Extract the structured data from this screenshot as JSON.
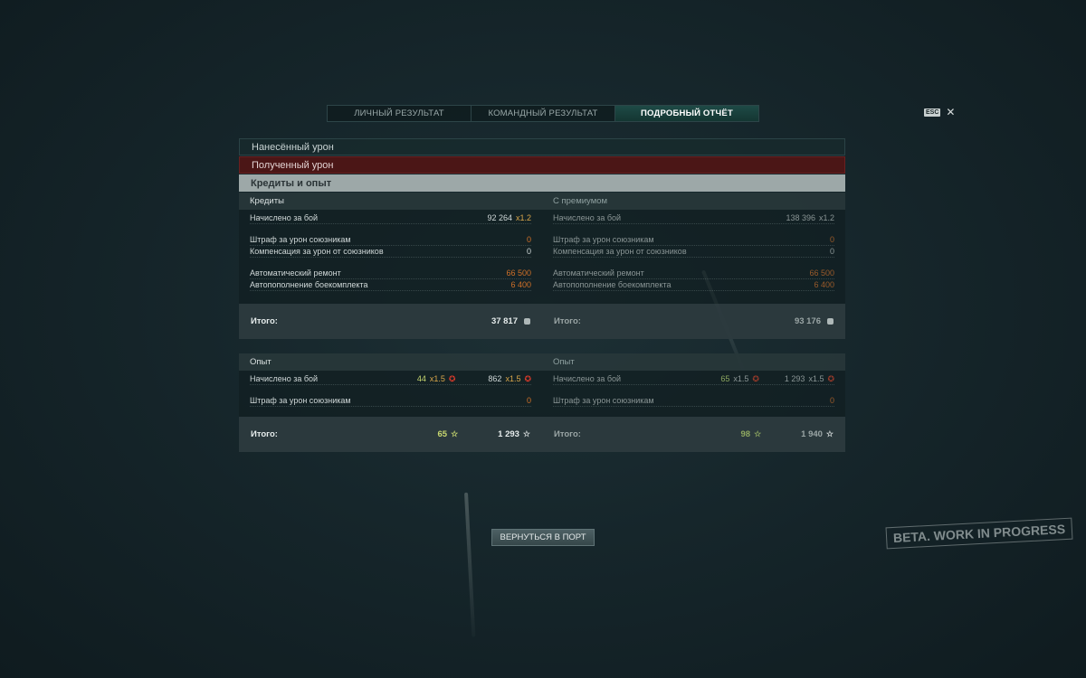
{
  "tabs": [
    {
      "label": "ЛИЧНЫЙ РЕЗУЛЬТАТ",
      "active": false
    },
    {
      "label": "КОМАНДНЫЙ РЕЗУЛЬТАТ",
      "active": false
    },
    {
      "label": "ПОДРОБНЫЙ ОТЧЁТ",
      "active": true
    }
  ],
  "esc": {
    "key": "ESC",
    "close": "✕"
  },
  "sections": {
    "damage_dealt": "Нанесённый урон",
    "damage_received": "Полученный урон",
    "credits_xp": "Кредиты и опыт"
  },
  "credits": {
    "header": "Кредиты",
    "earned_label": "Начислено за бой",
    "earned_value": "92 264",
    "earned_mult": "x1.2",
    "penalty_label": "Штраф за урон союзникам",
    "penalty_value": "0",
    "compensation_label": "Компенсация за урон от союзников",
    "compensation_value": "0",
    "repair_label": "Автоматический ремонт",
    "repair_value": "66 500",
    "resupply_label": "Автопополнение боекомплекта",
    "resupply_value": "6 400",
    "total_label": "Итого:",
    "total_value": "37 817"
  },
  "credits_premium": {
    "header": "С премиумом",
    "earned_label": "Начислено за бой",
    "earned_value": "138 396",
    "earned_mult": "x1.2",
    "penalty_label": "Штраф за урон союзникам",
    "penalty_value": "0",
    "compensation_label": "Компенсация за урон от союзников",
    "compensation_value": "0",
    "repair_label": "Автоматический ремонт",
    "repair_value": "66 500",
    "resupply_label": "Автопополнение боекомплекта",
    "resupply_value": "6 400",
    "total_label": "Итого:",
    "total_value": "93 176"
  },
  "xp": {
    "header": "Опыт",
    "earned_label": "Начислено за бой",
    "earned_ship": "44",
    "earned_ship_mult": "x1.5",
    "earned_total": "862",
    "earned_total_mult": "x1.5",
    "penalty_label": "Штраф за урон союзникам",
    "penalty_value": "0",
    "total_label": "Итого:",
    "total_ship": "65",
    "total_value": "1 293"
  },
  "xp_premium": {
    "header": "Опыт",
    "earned_label": "Начислено за бой",
    "earned_ship": "65",
    "earned_ship_mult": "x1.5",
    "earned_total": "1 293",
    "earned_total_mult": "x1.5",
    "penalty_label": "Штраф за урон союзникам",
    "penalty_value": "0",
    "total_label": "Итого:",
    "total_ship": "98",
    "total_value": "1 940"
  },
  "return_button": "ВЕРНУТЬСЯ В ПОРТ",
  "beta_stamp": "BETA. WORK IN PROGRESS",
  "icons": {
    "credit": "credit-icon",
    "xp": "star-icon",
    "xp_bonus": "xp-bonus-icon"
  }
}
